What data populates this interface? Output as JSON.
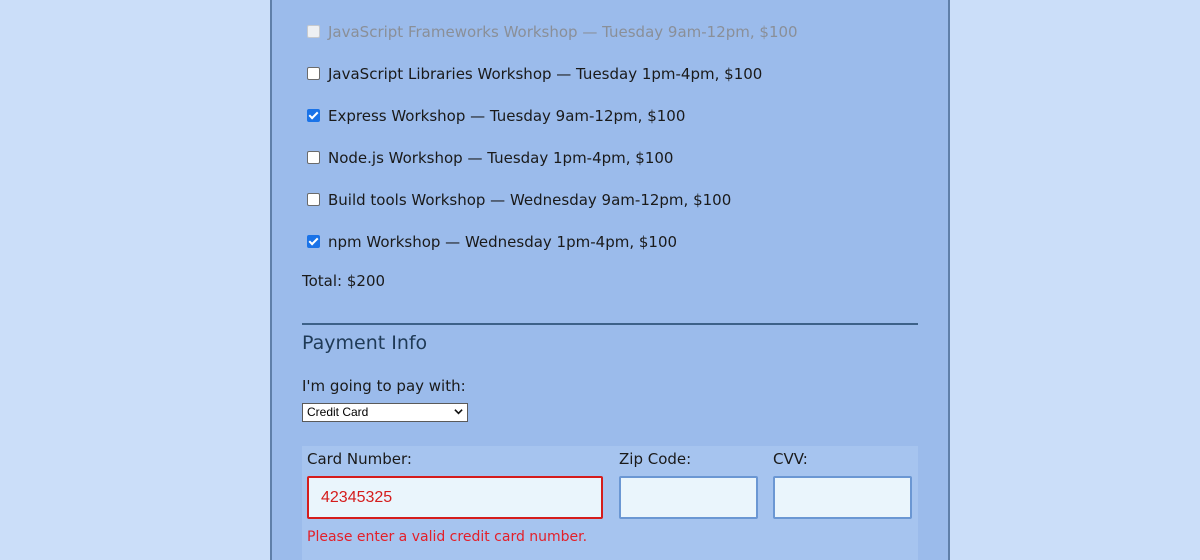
{
  "activities": [
    {
      "label": "JavaScript Frameworks Workshop — Tuesday 9am-12pm, $100",
      "checked": false,
      "disabled": true
    },
    {
      "label": "JavaScript Libraries Workshop — Tuesday 1pm-4pm, $100",
      "checked": false,
      "disabled": false
    },
    {
      "label": "Express Workshop — Tuesday 9am-12pm, $100",
      "checked": true,
      "disabled": false
    },
    {
      "label": "Node.js Workshop — Tuesday 1pm-4pm, $100",
      "checked": false,
      "disabled": false
    },
    {
      "label": "Build tools Workshop — Wednesday 9am-12pm, $100",
      "checked": false,
      "disabled": false
    },
    {
      "label": "npm Workshop — Wednesday 1pm-4pm, $100",
      "checked": true,
      "disabled": false
    }
  ],
  "total": "Total: $200",
  "payment": {
    "title": "Payment Info",
    "pay_label": "I'm going to pay with:",
    "selected_method": "Credit Card",
    "card_number_label": "Card Number:",
    "card_number_value": "42345325",
    "zip_label": "Zip Code:",
    "zip_value": "",
    "cvv_label": "CVV:",
    "cvv_value": "",
    "card_error": "Please enter a valid credit card number."
  },
  "colors": {
    "page_bg": "#cbdef9",
    "panel_bg": "#9bbbeb",
    "error": "#d51c1c",
    "checkbox_checked": "#1a73e8"
  },
  "icons": {
    "select_arrow": "chevron-down-icon",
    "checked_mark": "checkmark-icon"
  }
}
